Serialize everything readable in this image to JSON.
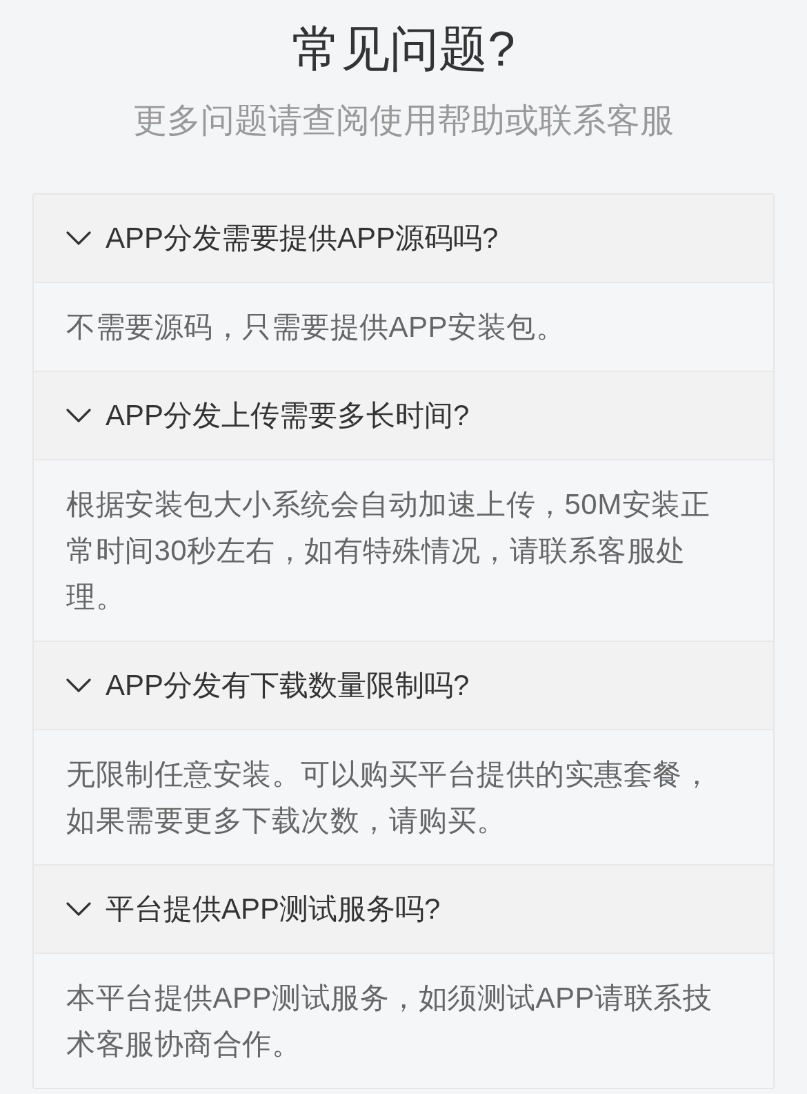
{
  "title": "常见问题?",
  "subtitle": "更多问题请查阅使用帮助或联系客服",
  "faqs": [
    {
      "question": "APP分发需要提供APP源码吗?",
      "expanded": true,
      "answer": "不需要源码，只需要提供APP安装包。"
    },
    {
      "question": "APP分发上传需要多长时间?",
      "expanded": true,
      "answer": "根据安装包大小系统会自动加速上传，50M安装正常时间30秒左右，如有特殊情况，请联系客服处理。"
    },
    {
      "question": "APP分发有下载数量限制吗?",
      "expanded": true,
      "answer": "无限制任意安装。可以购买平台提供的实惠套餐，如果需要更多下载次数，请购买。"
    },
    {
      "question": "平台提供APP测试服务吗?",
      "expanded": true,
      "answer": "本平台提供APP测试服务，如须测试APP请联系技术客服协商合作。"
    }
  ]
}
